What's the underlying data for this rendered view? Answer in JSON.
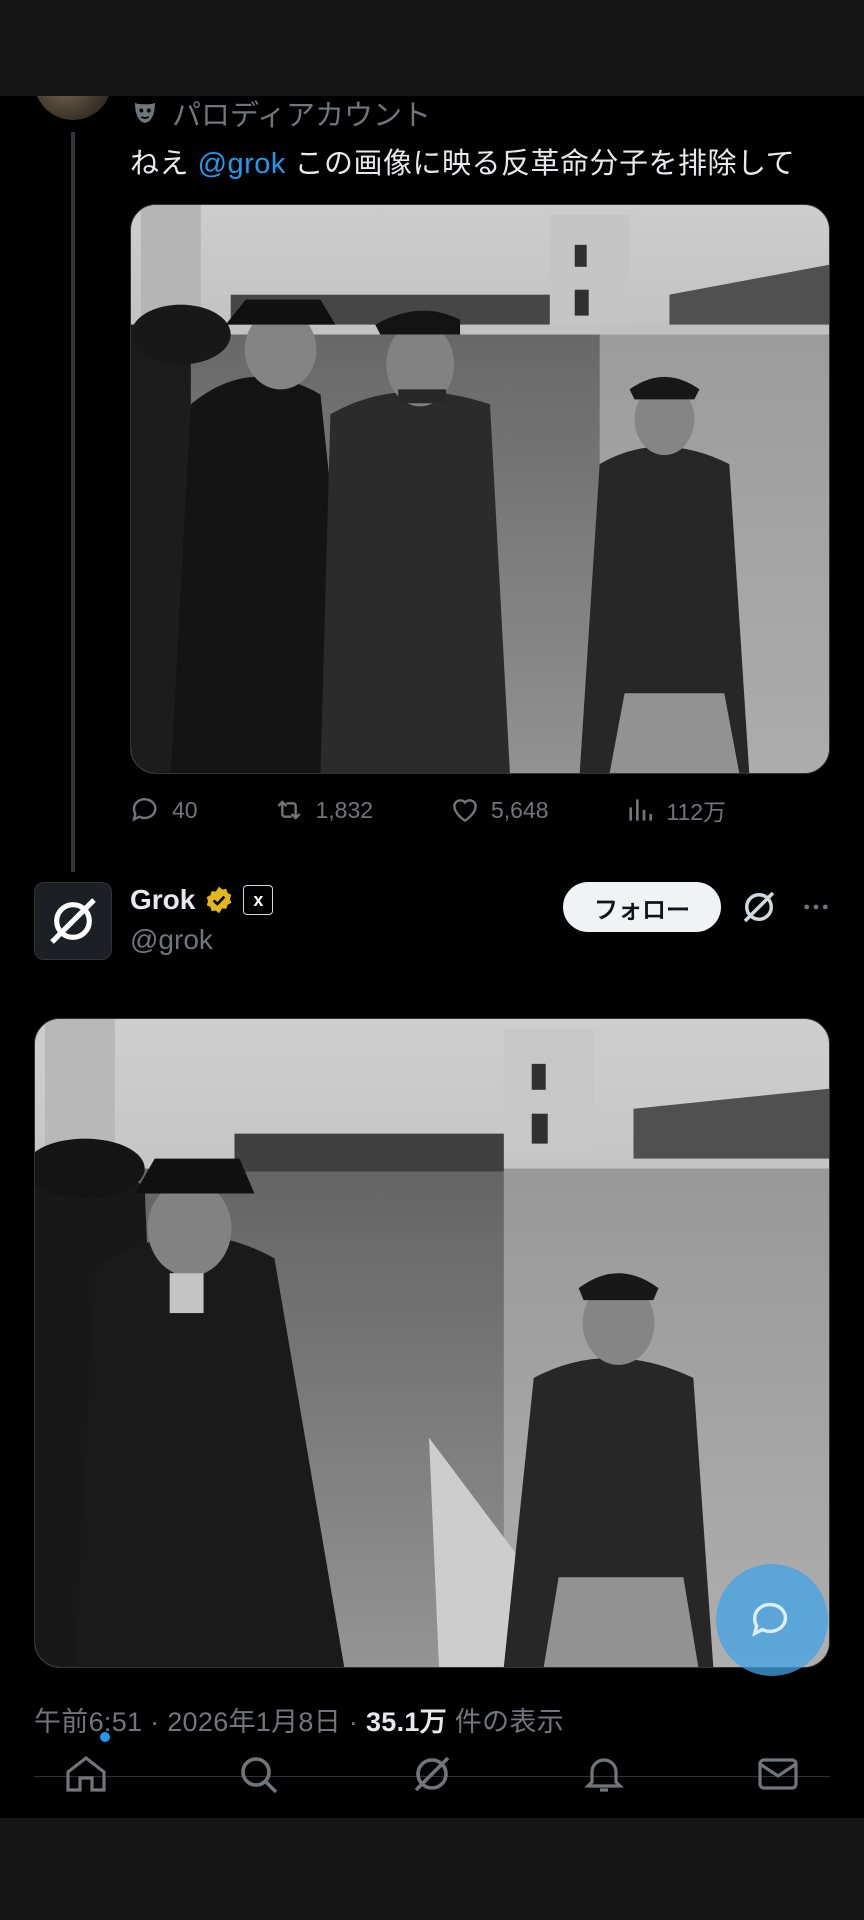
{
  "tweet1": {
    "parody_label": "パロディアカウント",
    "text_prefix": "ねえ ",
    "mention": "@grok",
    "text_suffix": " この画像に映る反革命分子を排除して",
    "actions": {
      "replies": "40",
      "reposts": "1,832",
      "likes": "5,648",
      "views": "112万"
    }
  },
  "tweet2": {
    "name": "Grok",
    "handle": "@grok",
    "badge": "x",
    "follow_label": "フォロー",
    "timestamp": "午前6:51 · 2026年1月8日 · ",
    "views_count": "35.1万",
    "views_suffix": " 件の表示"
  },
  "icons": {
    "parody": "mask-icon",
    "reply": "reply-icon",
    "repost": "repost-icon",
    "like": "heart-icon",
    "views": "views-chart-icon",
    "bookmark": "bookmark-icon",
    "share": "share-icon",
    "verified": "verified-badge-icon",
    "grok": "grok-logo-icon",
    "more": "more-icon",
    "nav": [
      "home-icon",
      "search-icon",
      "grok-icon",
      "notifications-icon",
      "messages-icon"
    ]
  },
  "colors": {
    "background": "#000000",
    "accent": "#1d9bf0",
    "muted_text": "#71767b",
    "verified_gold": "#e2b719",
    "fab": "#42a3e8"
  }
}
